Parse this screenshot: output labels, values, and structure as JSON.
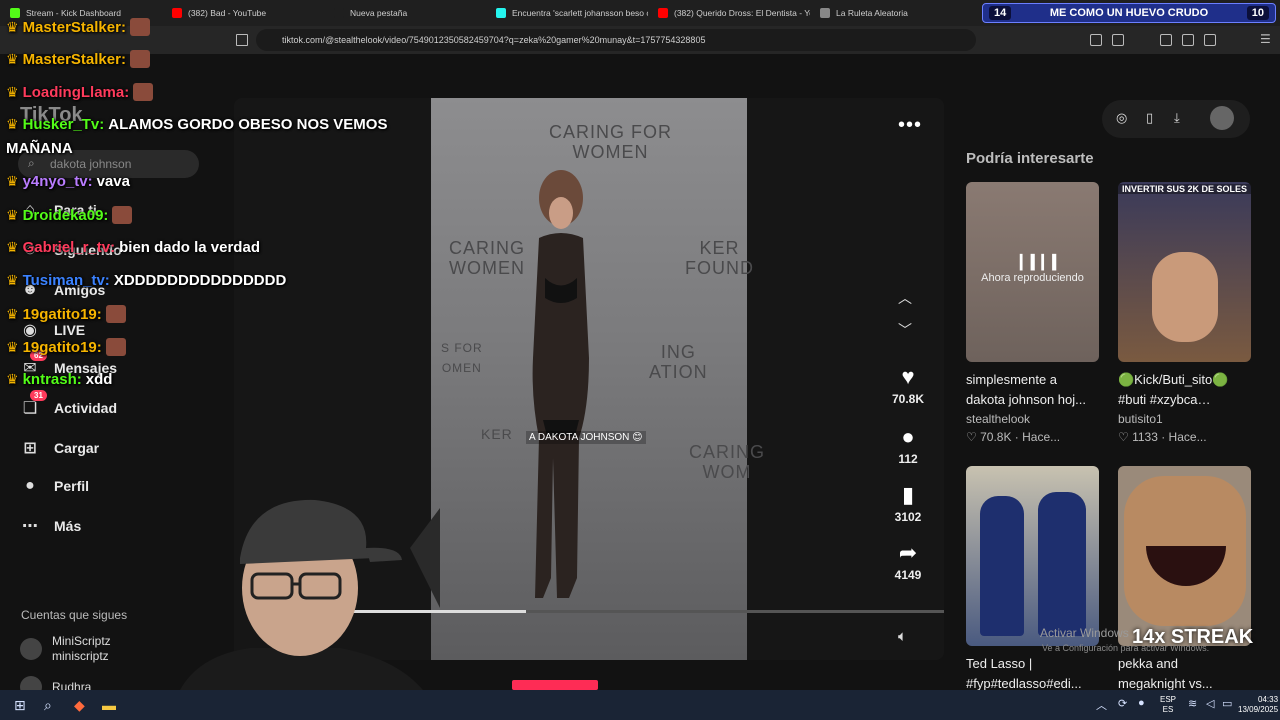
{
  "browser": {
    "tabs": [
      {
        "title": "Stream - Kick Dashboard",
        "color": "#53fc18"
      },
      {
        "title": "(382) Bad - YouTube",
        "color": "#ff0000"
      },
      {
        "title": "Nueva pestaña",
        "color": "#1f1f1f"
      },
      {
        "title": "Encuentra 'scarlett johansson beso c...",
        "color": "#25f4ee"
      },
      {
        "title": "(382) Querido Dross: El Dentista - Yo...",
        "color": "#ff0000"
      },
      {
        "title": "La Ruleta Aleatoria",
        "color": "#888888"
      }
    ],
    "url": "tiktok.com/@stealthelook/video/7549012350582459704?q=zeka%20gamer%20munay&t=1757754328805"
  },
  "stream_bar": {
    "left_num": "14",
    "text": "ME COMO UN HUEVO CRUDO",
    "right_num": "10"
  },
  "tiktok": {
    "logo": "TikTok",
    "search_placeholder": "dakota johnson",
    "nav": [
      {
        "label": "Para ti",
        "icon": "home-icon",
        "badge": ""
      },
      {
        "label": "Siguiendo",
        "icon": "following-icon",
        "badge": ""
      },
      {
        "label": "Amigos",
        "icon": "friends-icon",
        "badge": ""
      },
      {
        "label": "LIVE",
        "icon": "live-icon",
        "badge": ""
      },
      {
        "label": "Mensajes",
        "icon": "messages-icon",
        "badge": "62"
      },
      {
        "label": "Actividad",
        "icon": "activity-icon",
        "badge": "31"
      },
      {
        "label": "Cargar",
        "icon": "upload-icon",
        "badge": ""
      },
      {
        "label": "Perfil",
        "icon": "profile-icon",
        "badge": ""
      },
      {
        "label": "Más",
        "icon": "more-icon",
        "badge": ""
      }
    ],
    "following_title": "Cuentas que sigues",
    "following": [
      {
        "name": "MiniScriptz",
        "handle": "miniscriptz"
      },
      {
        "name": "Rudhra",
        "handle": ""
      }
    ],
    "video": {
      "wall_text": [
        "CARING FOR",
        "WOMEN",
        "CARING",
        "WOMEN",
        "KER",
        "FOUND",
        "S FOR",
        "OMEN",
        "ING",
        "ATION",
        "CARING",
        "WOM",
        "KER"
      ],
      "caption": "A DAKOTA JOHNSON 😊",
      "progress": 0.32,
      "likes": "70.8K",
      "comments": "112",
      "saves": "3102",
      "shares": "4149"
    },
    "rail_title": "Podría interesarte",
    "cards": [
      {
        "line1": "simplesmente a",
        "line2": "dakota johnson hoj...",
        "author": "stealthelook",
        "stats": "♡ 70.8K · Hace...",
        "overlay": "Ahora reproduciendo"
      },
      {
        "line1": "🟢Kick/Buti_sito🟢",
        "line2": "#buti #xzybca…",
        "author": "butisito1",
        "stats": "♡ 1133 · Hace...",
        "overlay": "INVERTIR SUS 2K DE SOLES"
      },
      {
        "line1": "Ted Lasso |",
        "line2": "#fyp#tedlasso#edi...",
        "author": "",
        "stats": "",
        "overlay": ""
      },
      {
        "line1": "pekka and",
        "line2": "megaknight vs...",
        "author": "",
        "stats": "",
        "overlay": ""
      }
    ]
  },
  "chat": [
    {
      "user": "MasterStalker:",
      "msg": "",
      "color": "#f5b400"
    },
    {
      "user": "MasterStalker:",
      "msg": "",
      "color": "#f5b400"
    },
    {
      "user": "LoadingLlama:",
      "msg": "",
      "color": "#ff3b5c"
    },
    {
      "user": "Husker_Tv:",
      "msg": "ALAMOS GORDO OBESO NOS VEMOS",
      "color": "#53fc18"
    },
    {
      "user": "",
      "msg": "MAÑANA",
      "color": "#ffffff"
    },
    {
      "user": "y4nyo_tv:",
      "msg": "vava",
      "color": "#b97cff"
    },
    {
      "user": "Droideka09:",
      "msg": "",
      "color": "#53fc18"
    },
    {
      "user": "Gabriel_r_tv:",
      "msg": "bien dado la verdad",
      "color": "#ff3b5c"
    },
    {
      "user": "Tusiman_tv:",
      "msg": "XDDDDDDDDDDDDDDD",
      "color": "#3b82ff"
    },
    {
      "user": "19gatito19:",
      "msg": "",
      "color": "#f5b400"
    },
    {
      "user": "19gatito19:",
      "msg": "",
      "color": "#f5b400"
    },
    {
      "user": "kntrash:",
      "msg": "xdd",
      "color": "#53fc18"
    }
  ],
  "watermark": {
    "line1": "Activar Windows",
    "line2": "Ve a Configuración para activar Windows."
  },
  "streak": "14x STREAK",
  "taskbar": {
    "lang1": "ESP",
    "lang2": "ES",
    "time": "04:33",
    "date": "13/09/2025"
  }
}
